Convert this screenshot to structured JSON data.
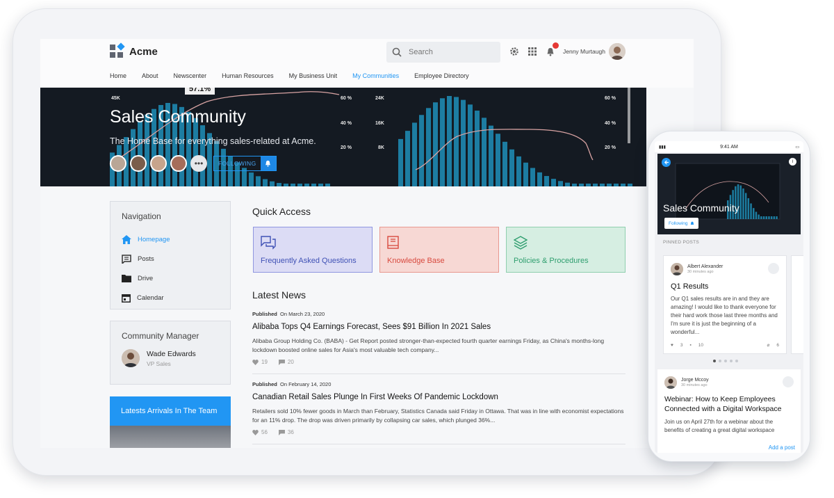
{
  "app": {
    "name": "Acme",
    "search_placeholder": "Search",
    "user_name": "Jenny Murtaugh"
  },
  "nav": [
    "Home",
    "About",
    "Newscenter",
    "Human Resources",
    "My Business Unit",
    "My Communities",
    "Employee Directory"
  ],
  "nav_active": "My Communities",
  "hero": {
    "title": "Sales Community",
    "subtitle": "The Home Base for everything sales-related at Acme.",
    "follow_label": "FOLLOWING",
    "percent_tag": "57.1%",
    "axis_left": [
      "60 %",
      "40 %",
      "20 %"
    ],
    "axis_mid": [
      "24K",
      "16K",
      "8K"
    ],
    "axis_right": [
      "60 %",
      "40 %",
      "20 %"
    ],
    "axis_top_left": "45K"
  },
  "sidebar": {
    "nav_title": "Navigation",
    "nav_items": [
      {
        "label": "Homepage",
        "icon": "home-icon",
        "active": true
      },
      {
        "label": "Posts",
        "icon": "posts-icon",
        "active": false
      },
      {
        "label": "Drive",
        "icon": "folder-icon",
        "active": false
      },
      {
        "label": "Calendar",
        "icon": "calendar-icon",
        "active": false
      }
    ],
    "manager_title": "Community Manager",
    "manager_name": "Wade Edwards",
    "manager_role": "VP Sales",
    "arrivals_title": "Latests Arrivals In The Team"
  },
  "quick_access": {
    "title": "Quick Access",
    "cards": [
      {
        "label": "Frequently Asked Questions",
        "icon": "chat-icon",
        "color": "#3f51b5",
        "bg": "#dcdcf5",
        "border": "#8f96e0"
      },
      {
        "label": "Knowledge Base",
        "icon": "book-icon",
        "color": "#d84a3f",
        "bg": "#f7d8d4",
        "border": "#e8988f"
      },
      {
        "label": "Policies & Procedures",
        "icon": "layers-icon",
        "color": "#2e9e6e",
        "bg": "#d6eee2",
        "border": "#8fcfae"
      }
    ]
  },
  "news": {
    "title": "Latest News",
    "published_label": "Published",
    "items": [
      {
        "date": "On March 23, 2020",
        "title": "Alibaba Tops Q4 Earnings Forecast, Sees $91 Billion In 2021 Sales",
        "body": "Alibaba Group Holding Co. (BABA) - Get Report posted stronger-than-expected fourth quarter earnings Friday, as China's months-long lockdown boosted online sales for Asia's most valuable tech company...",
        "likes": "19",
        "comments": "20"
      },
      {
        "date": "On February 14, 2020",
        "title": "Canadian Retail Sales Plunge In First Weeks Of Pandemic Lockdown",
        "body": "Retailers sold 10% fewer goods in March than February, Statistics Canada said Friday in Ottawa. That was in line with economist expectations for an 11% drop. The drop was driven primarily by collapsing car sales, which plunged 36%...",
        "likes": "56",
        "comments": "36"
      }
    ]
  },
  "phone": {
    "time": "9:41 AM",
    "title": "Sales Community",
    "follow_label": "Following",
    "pinned_label": "PINNED POSTS",
    "post": {
      "author": "Albert Alexander",
      "time": "30 minutes ago",
      "title": "Q1 Results",
      "body": "Our Q1 sales results are in and they are amazing! I would like to thank everyone for their hard work those last three months and I'm sure it is just the beginning of a wonderful...",
      "likes": "3",
      "comments": "10",
      "attachments": "6"
    },
    "webinar": {
      "author": "Jorge Mccoy",
      "time": "30 minutes ago",
      "title": "Webinar: How to Keep Employees Connected with a Digital Workspace",
      "body": "Join us on April 27th for a webinar about the benefits of creating a great digital workspace"
    },
    "add_post": "Add a post"
  }
}
